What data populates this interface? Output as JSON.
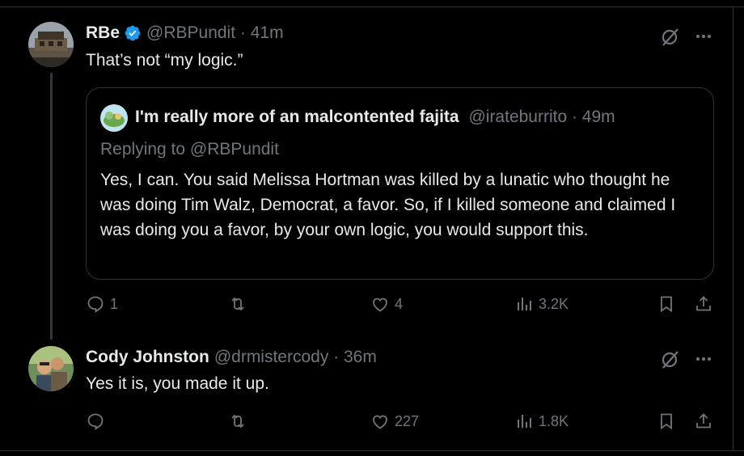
{
  "tweet1": {
    "name": "RBe",
    "handle_time": "@RBPundit · 41m",
    "text": "That’s not “my logic.”",
    "quote": {
      "name": "I'm really more of an malcontented fajita",
      "handle_time": "@irateburrito · 49m",
      "replying": "Replying to @RBPundit",
      "text": "Yes, I can. You said Melissa Hortman was killed by a lunatic who thought he was doing Tim Walz, Democrat, a favor. So, if I killed someone and claimed I was doing you a favor, by your own logic, you would support this."
    },
    "replies": "1",
    "retweets": "",
    "likes": "4",
    "views": "3.2K"
  },
  "tweet2": {
    "name": "Cody Johnston",
    "handle_time": "@drmistercody · 36m",
    "text": "Yes it is, you made it up.",
    "replies": "",
    "retweets": "",
    "likes": "227",
    "views": "1.8K"
  },
  "icons": [
    "verified-badge-icon",
    "grok-icon",
    "more-icon",
    "reply-icon",
    "retweet-icon",
    "like-icon",
    "views-icon",
    "bookmark-icon",
    "share-icon"
  ],
  "colors": {
    "background": "#000000",
    "text": "#e7e9ea",
    "muted": "#71767b",
    "border": "#2f3336",
    "verified": "#1d9bf0"
  }
}
